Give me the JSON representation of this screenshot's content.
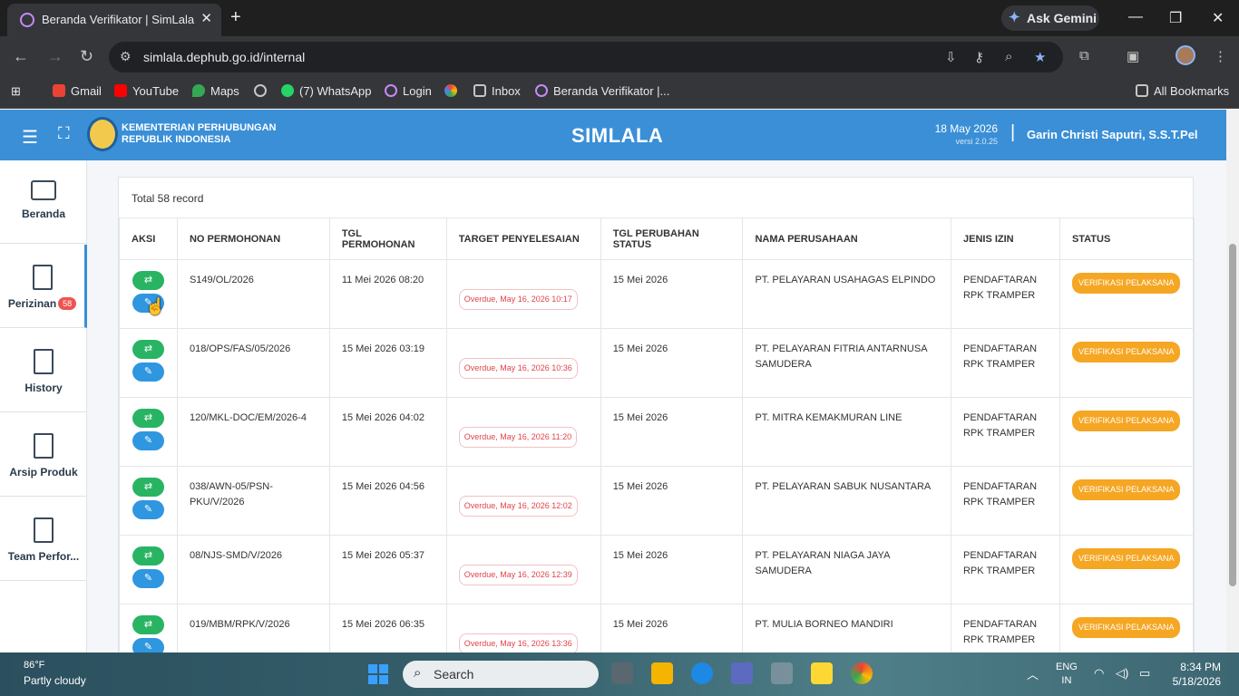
{
  "browser": {
    "tab_title": "Beranda Verifikator | SimLala",
    "ask_gemini": "Ask Gemini",
    "url": "simlala.dephub.go.id/internal",
    "bookmarks": [
      "Gmail",
      "YouTube",
      "Maps",
      "(7) WhatsApp",
      "Login",
      "Inbox",
      "Beranda Verifikator |..."
    ],
    "all_bookmarks": "All Bookmarks"
  },
  "header": {
    "org_line1": "KEMENTERIAN PERHUBUNGAN",
    "org_line2": "REPUBLIK INDONESIA",
    "app_title": "SIMLALA",
    "date": "18 May 2026",
    "version": "versi 2.0.25",
    "user": "Garin Christi Saputri, S.S.T.Pel"
  },
  "sidebar": {
    "items": [
      {
        "label": "Beranda"
      },
      {
        "label": "Perizinan",
        "badge": "58"
      },
      {
        "label": "History"
      },
      {
        "label": "Arsip Produk"
      },
      {
        "label": "Team Perfor..."
      }
    ]
  },
  "table": {
    "total": "Total 58 record",
    "columns": [
      "AKSI",
      "NO PERMOHONAN",
      "TGL PERMOHONAN",
      "TARGET PENYELESAIAN",
      "TGL PERUBAHAN STATUS",
      "NAMA PERUSAHAAN",
      "JENIS IZIN",
      "STATUS"
    ],
    "rows": [
      {
        "no": "S149/OL/2026",
        "tgl": "11 Mei 2026 08:20",
        "target": "Overdue, May 16, 2026 10:17",
        "tgl_status": "15 Mei 2026",
        "perusahaan": "PT. PELAYARAN USAHAGAS ELPINDO",
        "jenis": "PENDAFTARAN RPK TRAMPER",
        "status": "VERIFIKASI PELAKSANA"
      },
      {
        "no": "018/OPS/FAS/05/2026",
        "tgl": "15 Mei 2026 03:19",
        "target": "Overdue, May 16, 2026 10:36",
        "tgl_status": "15 Mei 2026",
        "perusahaan": "PT. PELAYARAN FITRIA ANTARNUSA SAMUDERA",
        "jenis": "PENDAFTARAN RPK TRAMPER",
        "status": "VERIFIKASI PELAKSANA"
      },
      {
        "no": "120/MKL-DOC/EM/2026-4",
        "tgl": "15 Mei 2026 04:02",
        "target": "Overdue, May 16, 2026 11:20",
        "tgl_status": "15 Mei 2026",
        "perusahaan": "PT. MITRA KEMAKMURAN LINE",
        "jenis": "PENDAFTARAN RPK TRAMPER",
        "status": "VERIFIKASI PELAKSANA"
      },
      {
        "no": "038/AWN-05/PSN-PKU/V/2026",
        "tgl": "15 Mei 2026 04:56",
        "target": "Overdue, May 16, 2026 12:02",
        "tgl_status": "15 Mei 2026",
        "perusahaan": "PT. PELAYARAN SABUK NUSANTARA",
        "jenis": "PENDAFTARAN RPK TRAMPER",
        "status": "VERIFIKASI PELAKSANA"
      },
      {
        "no": "08/NJS-SMD/V/2026",
        "tgl": "15 Mei 2026 05:37",
        "target": "Overdue, May 16, 2026 12:39",
        "tgl_status": "15 Mei 2026",
        "perusahaan": "PT. PELAYARAN NIAGA JAYA SAMUDERA",
        "jenis": "PENDAFTARAN RPK TRAMPER",
        "status": "VERIFIKASI PELAKSANA"
      },
      {
        "no": "019/MBM/RPK/V/2026",
        "tgl": "15 Mei 2026 06:35",
        "target": "Overdue, May 16, 2026 13:36",
        "tgl_status": "15 Mei 2026",
        "perusahaan": "PT. MULIA BORNEO MANDIRI",
        "jenis": "PENDAFTARAN RPK TRAMPER",
        "status": "VERIFIKASI PELAKSANA"
      }
    ]
  },
  "taskbar": {
    "temp": "86°F",
    "weather": "Partly cloudy",
    "search": "Search",
    "lang1": "ENG",
    "lang2": "IN",
    "time": "8:34 PM",
    "date": "5/18/2026"
  },
  "colors": {
    "header_blue": "#3a8fd6",
    "action_green": "#28b463",
    "action_blue": "#2f96e0",
    "status_orange": "#f5a623",
    "overdue_red": "#e0444a"
  }
}
